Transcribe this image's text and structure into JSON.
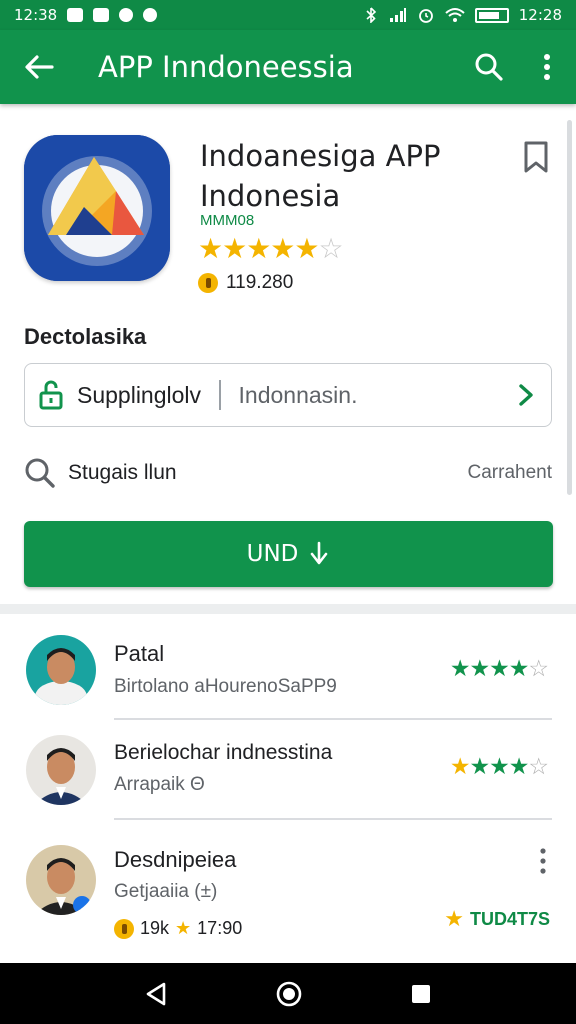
{
  "status_bar": {
    "time_left": "12:38",
    "time_right": "12:28",
    "colors": {
      "background": "#0f8a46"
    }
  },
  "app_bar": {
    "title": "APP Inndoneessia",
    "icons": [
      "back-arrow-icon",
      "search-icon",
      "more-vert-icon"
    ],
    "colors": {
      "background": "#11934c"
    }
  },
  "app": {
    "name": "Indoanesiga APP Indonesia",
    "developer": "MMM08",
    "rating_stars": 4,
    "rating_max": 5,
    "downloads": "119.280"
  },
  "section": {
    "title": "Dectolasika"
  },
  "info_card": {
    "label": "Supplinglolv",
    "value": "Indonnasin."
  },
  "search_row": {
    "label": "Stugais llun",
    "right": "Carrahent"
  },
  "install_button": {
    "label": "UND"
  },
  "reviews": [
    {
      "name": "Patal",
      "subtitle": "Birtolano aHourenoSaPP9",
      "stars": 4,
      "star_color": "green"
    },
    {
      "name": "Berielochar indnesstina",
      "subtitle": "Arrapaik Θ",
      "stars": 4,
      "star_color": "mixed"
    },
    {
      "name": "Desdnipeiea",
      "subtitle": "Getjaaiia (±)",
      "likes": "19k",
      "rating_text": "17:90",
      "badge": "TUD4T7S"
    }
  ],
  "colors": {
    "accent_green": "#11934c",
    "star_yellow": "#f4b400"
  }
}
